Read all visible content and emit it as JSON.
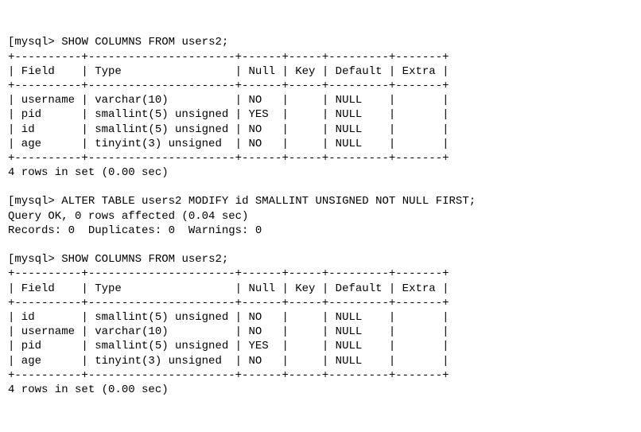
{
  "prompt": "mysql>",
  "bracket": "[",
  "commands": {
    "c1": "SHOW COLUMNS FROM users2;",
    "c2": "ALTER TABLE users2 MODIFY id SMALLINT UNSIGNED NOT NULL FIRST;",
    "c3": "SHOW COLUMNS FROM users2;"
  },
  "ascii": {
    "sep": "+----------+----------------------+------+-----+---------+-------+",
    "hdr": "| Field    | Type                 | Null | Key | Default | Extra |"
  },
  "table1": {
    "rows": [
      "| username | varchar(10)          | NO   |     | NULL    |       |",
      "| pid      | smallint(5) unsigned | YES  |     | NULL    |       |",
      "| id       | smallint(5) unsigned | NO   |     | NULL    |       |",
      "| age      | tinyint(3) unsigned  | NO   |     | NULL    |       |"
    ],
    "footer": "4 rows in set (0.00 sec)"
  },
  "result2": {
    "line1": "Query OK, 0 rows affected (0.04 sec)",
    "line2": "Records: 0  Duplicates: 0  Warnings: 0"
  },
  "table2": {
    "rows": [
      "| id       | smallint(5) unsigned | NO   |     | NULL    |       |",
      "| username | varchar(10)          | NO   |     | NULL    |       |",
      "| pid      | smallint(5) unsigned | YES  |     | NULL    |       |",
      "| age      | tinyint(3) unsigned  | NO   |     | NULL    |       |"
    ],
    "footer": "4 rows in set (0.00 sec)"
  },
  "chart_data": {
    "type": "table",
    "tables": [
      {
        "title": "SHOW COLUMNS FROM users2 (before)",
        "columns": [
          "Field",
          "Type",
          "Null",
          "Key",
          "Default",
          "Extra"
        ],
        "rows": [
          [
            "username",
            "varchar(10)",
            "NO",
            "",
            "NULL",
            ""
          ],
          [
            "pid",
            "smallint(5) unsigned",
            "YES",
            "",
            "NULL",
            ""
          ],
          [
            "id",
            "smallint(5) unsigned",
            "NO",
            "",
            "NULL",
            ""
          ],
          [
            "age",
            "tinyint(3) unsigned",
            "NO",
            "",
            "NULL",
            ""
          ]
        ]
      },
      {
        "title": "SHOW COLUMNS FROM users2 (after)",
        "columns": [
          "Field",
          "Type",
          "Null",
          "Key",
          "Default",
          "Extra"
        ],
        "rows": [
          [
            "id",
            "smallint(5) unsigned",
            "NO",
            "",
            "NULL",
            ""
          ],
          [
            "username",
            "varchar(10)",
            "NO",
            "",
            "NULL",
            ""
          ],
          [
            "pid",
            "smallint(5) unsigned",
            "YES",
            "",
            "NULL",
            ""
          ],
          [
            "age",
            "tinyint(3) unsigned",
            "NO",
            "",
            "NULL",
            ""
          ]
        ]
      }
    ]
  }
}
